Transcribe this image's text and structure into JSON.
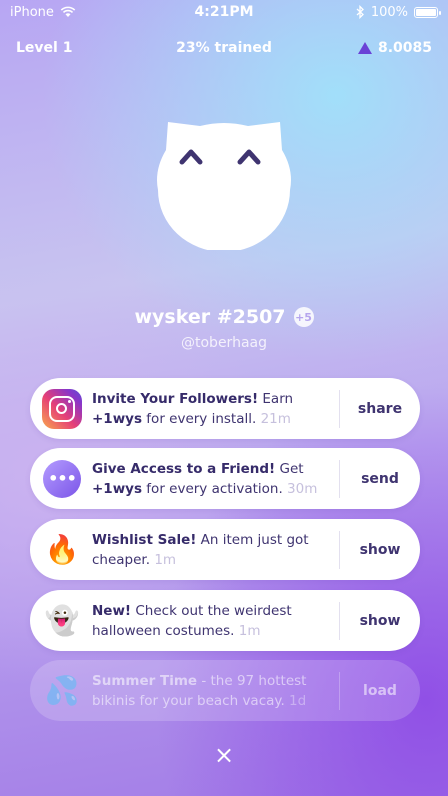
{
  "status_bar": {
    "carrier": "iPhone",
    "time": "4:21PM",
    "battery": "100%"
  },
  "header": {
    "level": "Level 1",
    "trained": "23% trained",
    "balance": "8.0085"
  },
  "profile": {
    "name": "wysker #2507",
    "handle": "@toberhaag",
    "badge": "+5"
  },
  "cards": [
    {
      "title": "Invite Your Followers!",
      "body_pre": " Earn ",
      "bold": "+1wys",
      "body_post": " for every install. ",
      "time": "21m",
      "action": "share",
      "icon": "instagram-icon"
    },
    {
      "title": "Give Access to a Friend!",
      "body_pre": " Get ",
      "bold": "+1wys",
      "body_post": " for every activation. ",
      "time": "30m",
      "action": "send",
      "icon": "chat-bubble-icon"
    },
    {
      "title": "Wishlist Sale!",
      "body": " An item just got cheaper. ",
      "time": "1m",
      "action": "show",
      "icon": "fire-emoji-icon",
      "emoji": "🔥"
    },
    {
      "title": "New!",
      "body": " Check out the weirdest halloween costumes. ",
      "time": "1m",
      "action": "show",
      "icon": "ghost-emoji-icon",
      "emoji": "👻"
    },
    {
      "title": "Summer Time",
      "body": " - the 97 hottest bikinis for your beach vacay. ",
      "time": "1d",
      "action": "load",
      "icon": "droplets-emoji-icon",
      "emoji": "💦"
    }
  ],
  "close_symbol": "×",
  "colors": {
    "accent": "#6a42d6",
    "text": "#3f3470",
    "card_bg": "#ffffff"
  }
}
